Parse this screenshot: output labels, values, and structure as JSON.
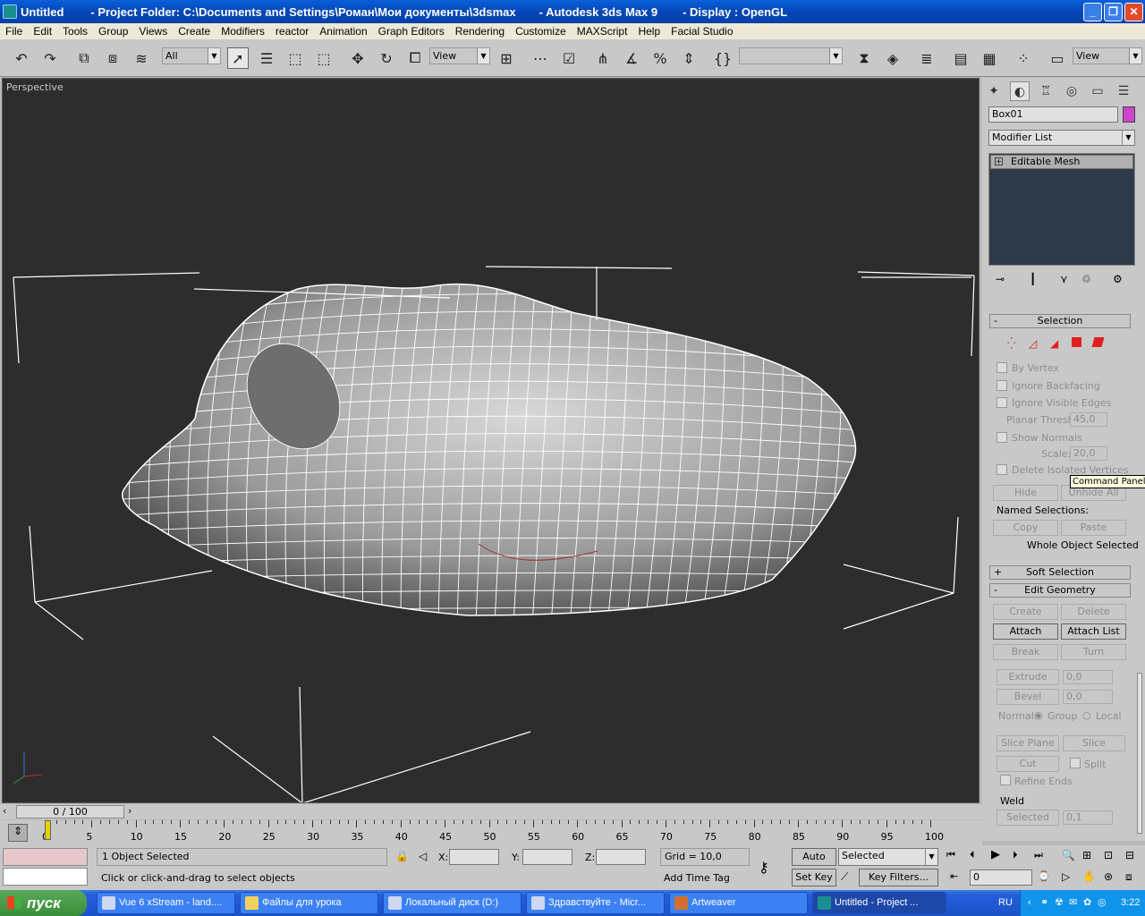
{
  "window": {
    "doc": "Untitled",
    "project": "- Project Folder: C:\\Documents and Settings\\Роман\\Мои документы\\3dsmax",
    "app": "- Autodesk 3ds Max 9",
    "display": "- Display : OpenGL"
  },
  "menu": [
    "File",
    "Edit",
    "Tools",
    "Group",
    "Views",
    "Create",
    "Modifiers",
    "reactor",
    "Animation",
    "Graph Editors",
    "Rendering",
    "Customize",
    "MAXScript",
    "Help",
    "Facial Studio"
  ],
  "toolbar": {
    "filter": "All",
    "coord": "View",
    "coord2": "View"
  },
  "viewport": {
    "label": "Perspective"
  },
  "panel": {
    "object_name": "Box01",
    "object_color": "#cc44cc",
    "modifier_list": "Modifier List",
    "stack_item": "Editable Mesh",
    "selection": {
      "title": "Selection",
      "by_vertex": "By Vertex",
      "ignore_backfacing": "Ignore Backfacing",
      "ignore_visible_edges": "Ignore Visible Edges",
      "planar_thresh": "Planar Thresh:",
      "planar_val": "45,0",
      "show_normals": "Show Normals",
      "scale": "Scale:",
      "scale_val": "20,0",
      "delete_isolated": "Delete Isolated Vertices",
      "hide": "Hide",
      "unhide_all": "Unhide All",
      "named_selections": "Named Selections:",
      "copy": "Copy",
      "paste": "Paste",
      "status": "Whole Object Selected"
    },
    "soft_selection": "Soft Selection",
    "edit_geometry": {
      "title": "Edit Geometry",
      "create": "Create",
      "delete": "Delete",
      "attach": "Attach",
      "attach_list": "Attach List",
      "break": "Break",
      "turn": "Turn",
      "extrude": "Extrude",
      "extrude_val": "0,0",
      "bevel": "Bevel",
      "bevel_val": "0,0",
      "normal": "Normal:",
      "group": "Group",
      "local": "Local",
      "slice_plane": "Slice Plane",
      "slice": "Slice",
      "cut": "Cut",
      "split": "Split",
      "refine_ends": "Refine Ends",
      "weld": "Weld",
      "selected": "Selected",
      "weld_val": "0,1"
    }
  },
  "tooltip": "Command Panel",
  "time": {
    "slider": "0 / 100",
    "ticks": [
      "0",
      "5",
      "10",
      "15",
      "20",
      "25",
      "30",
      "35",
      "40",
      "45",
      "50",
      "55",
      "60",
      "65",
      "70",
      "75",
      "80",
      "85",
      "90",
      "95",
      "100"
    ]
  },
  "status": {
    "selected": "1 Object Selected",
    "prompt": "Click or click-and-drag to select objects",
    "x": "X:",
    "y": "Y:",
    "z": "Z:",
    "grid": "Grid = 10,0",
    "add_time_tag": "Add Time Tag",
    "auto_key": "Auto Key",
    "set_key": "Set Key",
    "key_mode": "Selected",
    "key_filters": "Key Filters...",
    "frame": "0"
  },
  "taskbar": {
    "start": "пуск",
    "tasks": [
      "Vue 6 xStream - land....",
      "Файлы для урока",
      "Локальный диск (D:)",
      "Здравствуйте - Micr...",
      "Artweaver",
      "Untitled     - Project ..."
    ],
    "lang": "RU",
    "clock": "3:22"
  }
}
